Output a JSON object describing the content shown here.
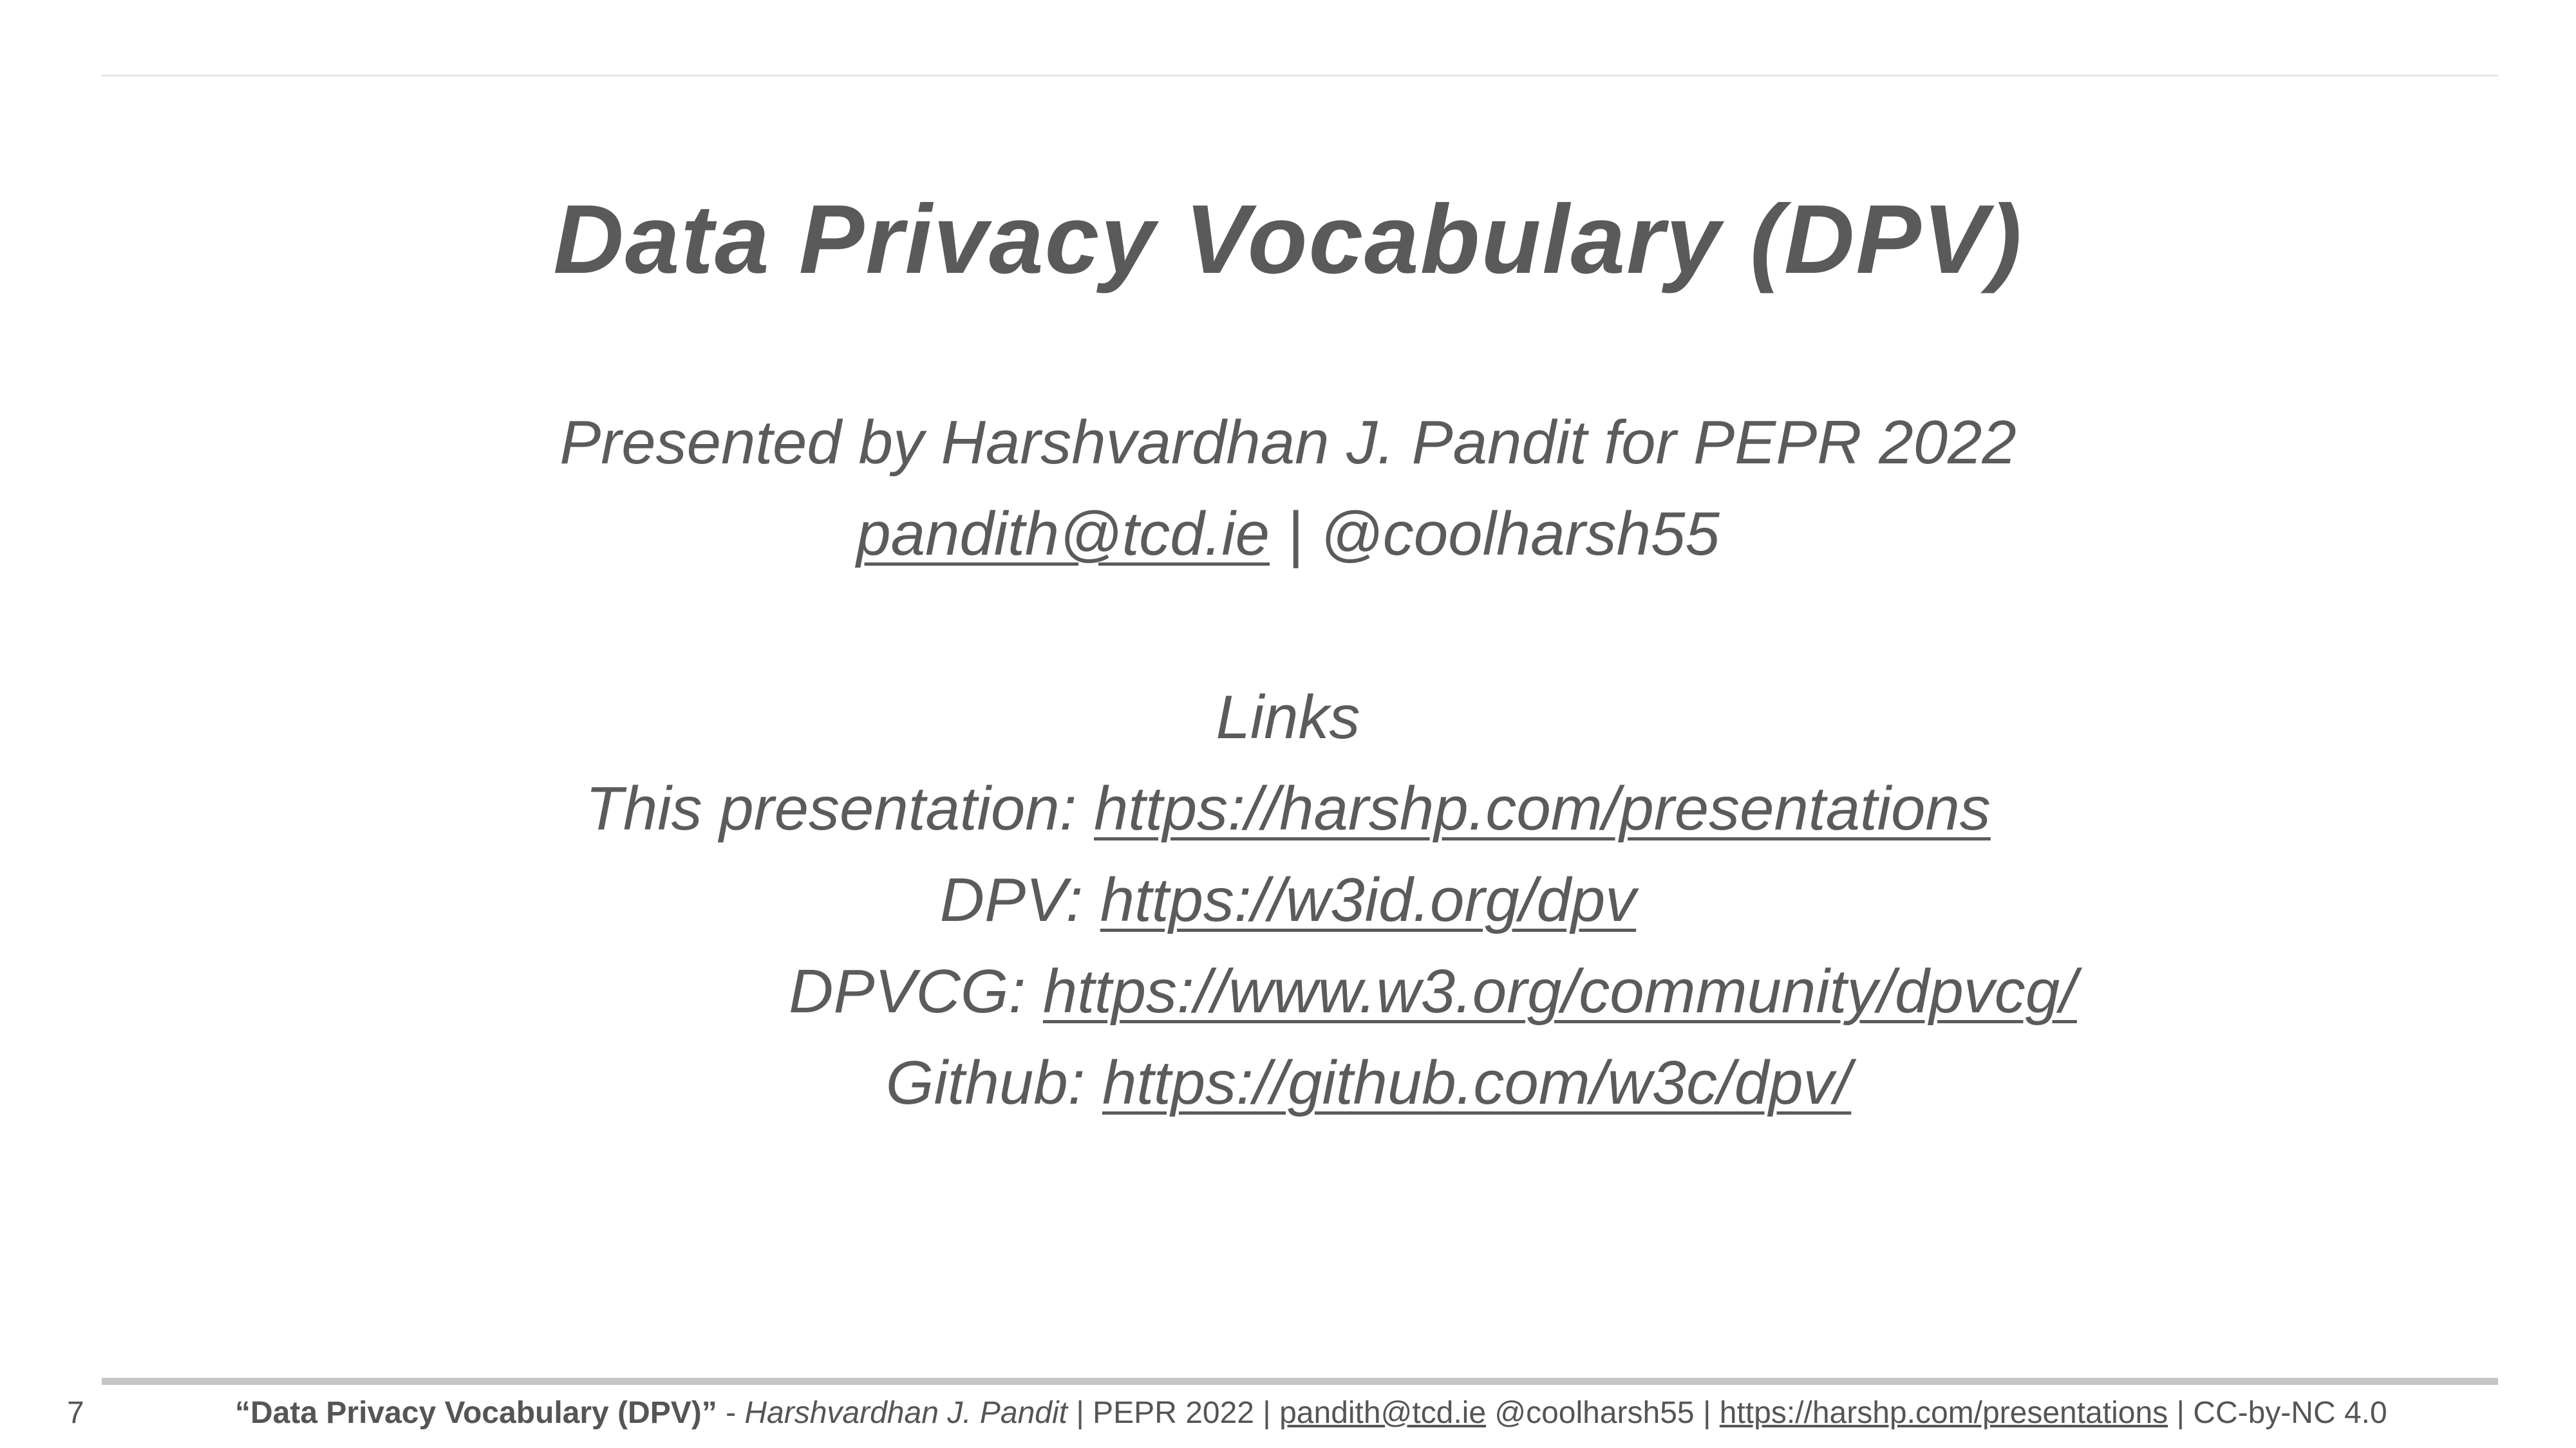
{
  "slide": {
    "title": "Data Privacy Vocabulary (DPV)",
    "presenter_line": "Presented by Harshvardhan J. Pandit for PEPR 2022",
    "email": "pandith@tcd.ie",
    "separator": " | ",
    "handle": "@coolharsh55",
    "links_heading": "Links",
    "links": [
      {
        "label": "This presentation: ",
        "url": "https://harshp.com/presentations"
      },
      {
        "label": "DPV: ",
        "url": "https://w3id.org/dpv"
      },
      {
        "label": "DPVCG: ",
        "url": "https://www.w3.org/community/dpvcg/"
      },
      {
        "label": "Github: ",
        "url": "https://github.com/w3c/dpv/"
      }
    ]
  },
  "footer": {
    "page_number": "7",
    "title": "“Data Privacy Vocabulary (DPV)”",
    "dash": " - ",
    "author": "Harshvardhan J. Pandit",
    "venue": " | PEPR 2022 | ",
    "email": "pandith@tcd.ie",
    "handle": " @coolharsh55 | ",
    "url": "https://harshp.com/presentations",
    "license": " | CC-by-NC 4.0"
  }
}
